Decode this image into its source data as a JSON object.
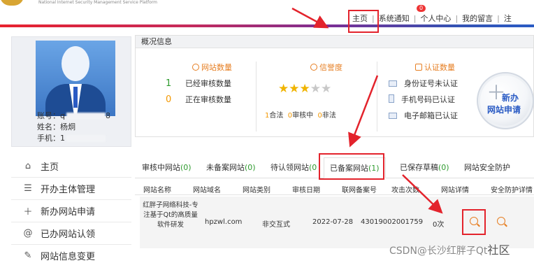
{
  "header": {
    "logo_subtitle": "National Internet Security Management Service Platform",
    "nav": [
      {
        "label": "主页"
      },
      {
        "label": "系统通知"
      },
      {
        "label": "个人中心"
      },
      {
        "label": "我的留言"
      },
      {
        "label": "注"
      }
    ],
    "notification_badge": "0",
    "separator": "|"
  },
  "profile": {
    "account_label": "账号：",
    "account_value": "q",
    "account_tail": "8",
    "name_label": "姓名：",
    "name_value": "杨炯",
    "phone_label": "手机：",
    "phone_value": "1"
  },
  "sidebar": {
    "items": [
      {
        "label": "主页",
        "icon": "home-icon"
      },
      {
        "label": "开办主体管理",
        "icon": "list-icon"
      },
      {
        "label": "新办网站申请",
        "icon": "plus-icon"
      },
      {
        "label": "已办网站认领",
        "icon": "at-icon"
      },
      {
        "label": "网站信息变更",
        "icon": "edit-icon"
      }
    ]
  },
  "overview": {
    "title": "概况信息",
    "site_count": {
      "heading": "网站数量",
      "rows": [
        {
          "num": "1",
          "label": "已经审核数量",
          "color": "#2e9b2e"
        },
        {
          "num": "0",
          "label": "正在审核数量",
          "color": "#f39800"
        }
      ]
    },
    "credit": {
      "heading": "信誉度",
      "stars_on": 3,
      "stars_total": 5,
      "legal_num": "1",
      "legal_label": "合法",
      "review_num": "0",
      "review_label": "审核中",
      "illegal_num": "0",
      "illegal_label": "非法"
    },
    "certification": {
      "heading": "认证数量",
      "items": [
        {
          "label": "身份证号未认证",
          "icon": "id-card-icon"
        },
        {
          "label": "手机号码已认证",
          "icon": "phone-icon"
        },
        {
          "label": "电子邮箱已认证",
          "icon": "mail-icon"
        }
      ]
    },
    "new_site_button": {
      "line1": "新办",
      "line2": "网站申请"
    }
  },
  "tabs": [
    {
      "label": "审核中网站",
      "count": "(0)"
    },
    {
      "label": "未备案网站",
      "count": "(0)"
    },
    {
      "label": "待认领网站",
      "count": "(0"
    },
    {
      "label": "已备案网站",
      "count": "(1)"
    },
    {
      "label": "已保存草稿",
      "count": "(0)"
    },
    {
      "label": "网站安全防护",
      "count": ""
    }
  ],
  "table": {
    "columns": [
      "网站名称",
      "网站域名",
      "网站类别",
      "审核日期",
      "联网备案号",
      "攻击次数",
      "网站详情",
      "安全防护详情"
    ],
    "rows": [
      {
        "name": "红胖子网络科技-专注基于Qt的高质量软件研发",
        "domain": "hpzwl.com",
        "category": "非交互式",
        "date": "2022-07-28",
        "record_no": "43019002001759",
        "attacks": "0次"
      }
    ]
  },
  "watermark": {
    "line1": "CSDN@长沙红胖子Qt",
    "line2": "社区"
  },
  "colors": {
    "accent_orange": "#e67e22",
    "count_green": "#2e9b2e",
    "highlight_red": "#e3232c",
    "brand_blue": "#2a5bc4"
  }
}
